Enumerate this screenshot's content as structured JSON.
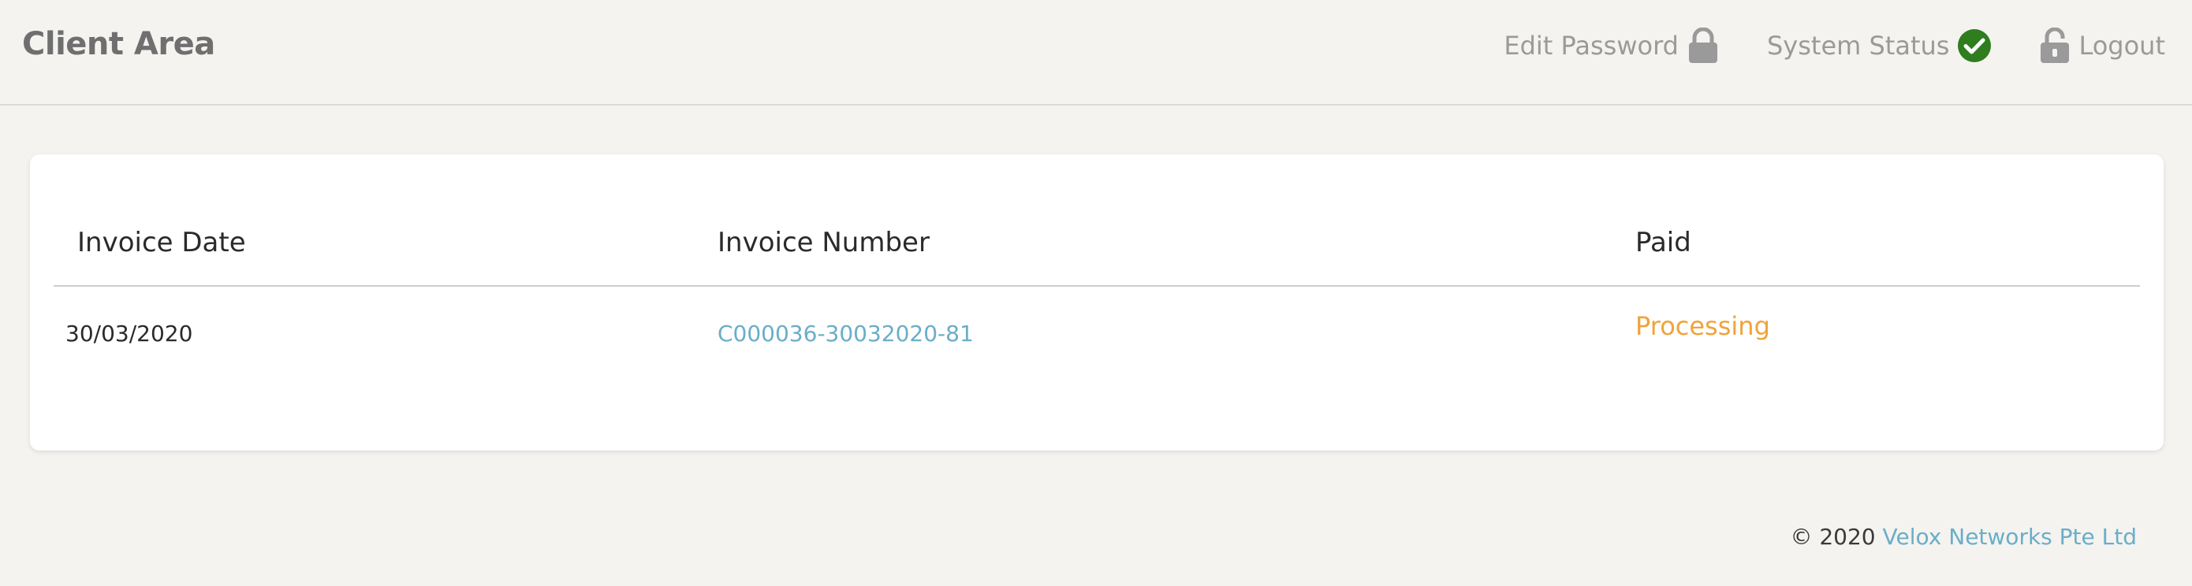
{
  "header": {
    "title": "Client Area",
    "nav": {
      "edit_password": "Edit Password",
      "system_status": "System Status",
      "logout": "Logout"
    },
    "icons": {
      "edit_password": "lock-icon",
      "system_status": "check-circle-icon",
      "logout": "unlock-icon"
    }
  },
  "invoices": {
    "columns": {
      "date": "Invoice Date",
      "number": "Invoice Number",
      "paid": "Paid"
    },
    "rows": [
      {
        "date": "30/03/2020",
        "number": "C000036-30032020-81",
        "paid": "Processing"
      }
    ]
  },
  "footer": {
    "copyright": "© 2020",
    "company": "Velox Networks Pte Ltd"
  },
  "colors": {
    "background": "#f4f3f0",
    "link": "#6aaec8",
    "status_processing": "#f0a33a",
    "status_ok": "#2e7d1f",
    "muted": "#9a9a9a"
  }
}
